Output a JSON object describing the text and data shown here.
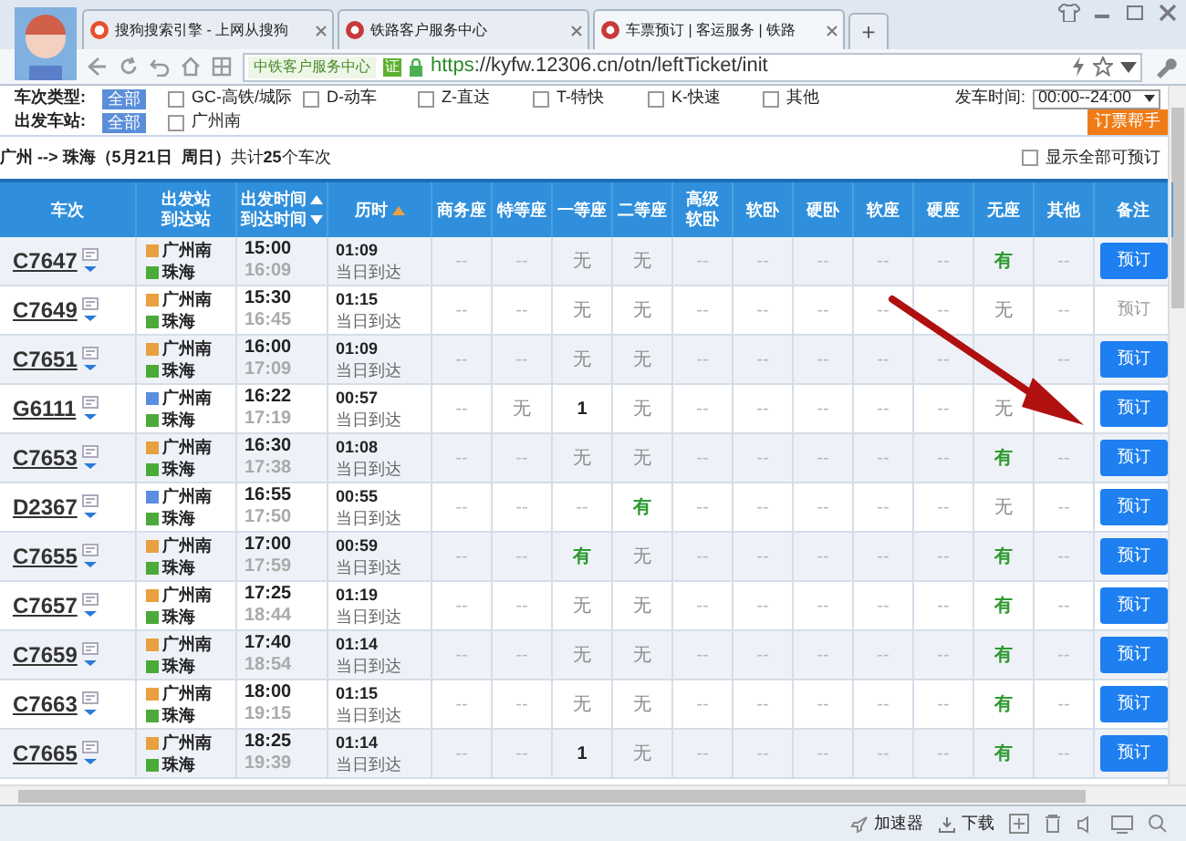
{
  "browser": {
    "tabs": [
      {
        "label": "搜狗搜索引擎 - 上网从搜狗",
        "selected": false
      },
      {
        "label": "铁路客户服务中心",
        "selected": false
      },
      {
        "label": "车票预订 | 客运服务 | 铁路",
        "selected": true
      }
    ],
    "new_tab": "+",
    "site_badge": "中铁客户服务中心",
    "badge_mark": "证",
    "url_scheme": "https",
    "url_rest": "://kyfw.12306.cn/otn/leftTicket/init"
  },
  "filters": {
    "type_label": "车次类型:",
    "type_all": "全部",
    "type_options": [
      {
        "label": "GC-高铁/城际",
        "checked": false
      },
      {
        "label": "D-动车",
        "checked": false
      },
      {
        "label": "Z-直达",
        "checked": false
      },
      {
        "label": "T-特快",
        "checked": false
      },
      {
        "label": "K-快速",
        "checked": false
      },
      {
        "label": "其他",
        "checked": false
      }
    ],
    "time_label": "发车时间:",
    "time_value": "00:00--24:00",
    "station_label": "出发车站:",
    "station_all": "全部",
    "station_options": [
      {
        "label": "广州南",
        "checked": false
      }
    ],
    "helper_button": "订票帮手"
  },
  "route": {
    "text": "**广州 --> 珠海（5月21日  周日）**共计**25**个车次",
    "show_all": {
      "label": "显示全部可预订",
      "checked": false
    }
  },
  "table": {
    "columns": [
      {
        "lines": [
          "车次"
        ]
      },
      {
        "lines": [
          "出发站",
          "到达站"
        ]
      },
      {
        "lines": [
          "出发时间",
          "到达时间"
        ],
        "sort_active": false
      },
      {
        "lines": [
          "历时"
        ],
        "sort_active": true
      },
      {
        "lines": [
          "商务座"
        ]
      },
      {
        "lines": [
          "特等座"
        ]
      },
      {
        "lines": [
          "一等座"
        ]
      },
      {
        "lines": [
          "二等座"
        ]
      },
      {
        "lines": [
          "高级",
          "软卧"
        ]
      },
      {
        "lines": [
          "软卧"
        ]
      },
      {
        "lines": [
          "硬卧"
        ]
      },
      {
        "lines": [
          "软座"
        ]
      },
      {
        "lines": [
          "硬座"
        ]
      },
      {
        "lines": [
          "无座"
        ]
      },
      {
        "lines": [
          "其他"
        ]
      },
      {
        "lines": [
          "备注"
        ]
      }
    ],
    "rows": [
      {
        "train": "C7647",
        "color": "#e8a040",
        "from": "广州南",
        "to": "珠海",
        "depart": "15:00",
        "arrive": "16:09",
        "duration": "01:09",
        "arrival_day": "当日到达",
        "seats": [
          {
            "text": "--",
            "kind": "na"
          },
          {
            "text": "--",
            "kind": "na"
          },
          {
            "text": "无",
            "kind": "none"
          },
          {
            "text": "无",
            "kind": "none"
          },
          {
            "text": "--",
            "kind": "na"
          },
          {
            "text": "--",
            "kind": "na"
          },
          {
            "text": "--",
            "kind": "na"
          },
          {
            "text": "--",
            "kind": "na"
          },
          {
            "text": "--",
            "kind": "na"
          },
          {
            "text": "有",
            "kind": "available"
          },
          {
            "text": "--",
            "kind": "na"
          }
        ],
        "book": {
          "label": "预订",
          "disabled": false
        }
      },
      {
        "train": "C7649",
        "color": "#e8a040",
        "from": "广州南",
        "to": "珠海",
        "depart": "15:30",
        "arrive": "16:45",
        "duration": "01:15",
        "arrival_day": "当日到达",
        "seats": [
          {
            "text": "--",
            "kind": "na"
          },
          {
            "text": "--",
            "kind": "na"
          },
          {
            "text": "无",
            "kind": "none"
          },
          {
            "text": "无",
            "kind": "none"
          },
          {
            "text": "--",
            "kind": "na"
          },
          {
            "text": "--",
            "kind": "na"
          },
          {
            "text": "--",
            "kind": "na"
          },
          {
            "text": "--",
            "kind": "na"
          },
          {
            "text": "--",
            "kind": "na"
          },
          {
            "text": "无",
            "kind": "none"
          },
          {
            "text": "--",
            "kind": "na"
          }
        ],
        "book": {
          "label": "预订",
          "disabled": true
        }
      },
      {
        "train": "C7651",
        "color": "#e8a040",
        "from": "广州南",
        "to": "珠海",
        "depart": "16:00",
        "arrive": "17:09",
        "duration": "01:09",
        "arrival_day": "当日到达",
        "seats": [
          {
            "text": "--",
            "kind": "na"
          },
          {
            "text": "--",
            "kind": "na"
          },
          {
            "text": "无",
            "kind": "none"
          },
          {
            "text": "无",
            "kind": "none"
          },
          {
            "text": "--",
            "kind": "na"
          },
          {
            "text": "--",
            "kind": "na"
          },
          {
            "text": "--",
            "kind": "na"
          },
          {
            "text": "--",
            "kind": "na"
          },
          {
            "text": "--",
            "kind": "na"
          },
          {
            "kind": "covered"
          },
          {
            "text": "--",
            "kind": "na"
          }
        ],
        "book": {
          "label": "预订",
          "disabled": false
        }
      },
      {
        "train": "G6111",
        "color": "#5b8de0",
        "from": "广州南",
        "to": "珠海",
        "depart": "16:22",
        "arrive": "17:19",
        "duration": "00:57",
        "arrival_day": "当日到达",
        "seats": [
          {
            "text": "--",
            "kind": "na"
          },
          {
            "text": "无",
            "kind": "none"
          },
          {
            "text": "1",
            "kind": "count"
          },
          {
            "text": "无",
            "kind": "none"
          },
          {
            "text": "--",
            "kind": "na"
          },
          {
            "text": "--",
            "kind": "na"
          },
          {
            "text": "--",
            "kind": "na"
          },
          {
            "text": "--",
            "kind": "na"
          },
          {
            "text": "--",
            "kind": "na"
          },
          {
            "text": "无",
            "kind": "none"
          }
        ],
        "book": {
          "label": "预订",
          "disabled": false
        }
      },
      {
        "train": "C7653",
        "color": "#e8a040",
        "from": "广州南",
        "to": "珠海",
        "depart": "16:30",
        "arrive": "17:38",
        "duration": "01:08",
        "arrival_day": "当日到达",
        "seats": [
          {
            "text": "--",
            "kind": "na"
          },
          {
            "text": "--",
            "kind": "na"
          },
          {
            "text": "无",
            "kind": "none"
          },
          {
            "text": "无",
            "kind": "none"
          },
          {
            "text": "--",
            "kind": "na"
          },
          {
            "text": "--",
            "kind": "na"
          },
          {
            "text": "--",
            "kind": "na"
          },
          {
            "text": "--",
            "kind": "na"
          },
          {
            "text": "--",
            "kind": "na"
          },
          {
            "text": "有",
            "kind": "available"
          },
          {
            "text": "--",
            "kind": "na"
          }
        ],
        "book": {
          "label": "预订",
          "disabled": false
        }
      },
      {
        "train": "D2367",
        "color": "#5b8de0",
        "from": "广州南",
        "to": "珠海",
        "depart": "16:55",
        "arrive": "17:50",
        "duration": "00:55",
        "arrival_day": "当日到达",
        "seats": [
          {
            "text": "--",
            "kind": "na"
          },
          {
            "text": "--",
            "kind": "na"
          },
          {
            "text": "--",
            "kind": "na"
          },
          {
            "text": "有",
            "kind": "available"
          },
          {
            "text": "--",
            "kind": "na"
          },
          {
            "text": "--",
            "kind": "na"
          },
          {
            "text": "--",
            "kind": "na"
          },
          {
            "text": "--",
            "kind": "na"
          },
          {
            "text": "--",
            "kind": "na"
          },
          {
            "text": "无",
            "kind": "none"
          },
          {
            "text": "--",
            "kind": "na"
          }
        ],
        "book": {
          "label": "预订",
          "disabled": false
        }
      },
      {
        "train": "C7655",
        "color": "#e8a040",
        "from": "广州南",
        "to": "珠海",
        "depart": "17:00",
        "arrive": "17:59",
        "duration": "00:59",
        "arrival_day": "当日到达",
        "seats": [
          {
            "text": "--",
            "kind": "na"
          },
          {
            "text": "--",
            "kind": "na"
          },
          {
            "text": "有",
            "kind": "available"
          },
          {
            "text": "无",
            "kind": "none"
          },
          {
            "text": "--",
            "kind": "na"
          },
          {
            "text": "--",
            "kind": "na"
          },
          {
            "text": "--",
            "kind": "na"
          },
          {
            "text": "--",
            "kind": "na"
          },
          {
            "text": "--",
            "kind": "na"
          },
          {
            "text": "有",
            "kind": "available"
          },
          {
            "text": "--",
            "kind": "na"
          }
        ],
        "book": {
          "label": "预订",
          "disabled": false
        }
      },
      {
        "train": "C7657",
        "color": "#e8a040",
        "from": "广州南",
        "to": "珠海",
        "depart": "17:25",
        "arrive": "18:44",
        "duration": "01:19",
        "arrival_day": "当日到达",
        "seats": [
          {
            "text": "--",
            "kind": "na"
          },
          {
            "text": "--",
            "kind": "na"
          },
          {
            "text": "无",
            "kind": "none"
          },
          {
            "text": "无",
            "kind": "none"
          },
          {
            "text": "--",
            "kind": "na"
          },
          {
            "text": "--",
            "kind": "na"
          },
          {
            "text": "--",
            "kind": "na"
          },
          {
            "text": "--",
            "kind": "na"
          },
          {
            "text": "--",
            "kind": "na"
          },
          {
            "text": "有",
            "kind": "available"
          },
          {
            "text": "--",
            "kind": "na"
          }
        ],
        "book": {
          "label": "预订",
          "disabled": false
        }
      },
      {
        "train": "C7659",
        "color": "#e8a040",
        "from": "广州南",
        "to": "珠海",
        "depart": "17:40",
        "arrive": "18:54",
        "duration": "01:14",
        "arrival_day": "当日到达",
        "seats": [
          {
            "text": "--",
            "kind": "na"
          },
          {
            "text": "--",
            "kind": "na"
          },
          {
            "text": "无",
            "kind": "none"
          },
          {
            "text": "无",
            "kind": "none"
          },
          {
            "text": "--",
            "kind": "na"
          },
          {
            "text": "--",
            "kind": "na"
          },
          {
            "text": "--",
            "kind": "na"
          },
          {
            "text": "--",
            "kind": "na"
          },
          {
            "text": "--",
            "kind": "na"
          },
          {
            "text": "有",
            "kind": "available"
          },
          {
            "text": "--",
            "kind": "na"
          }
        ],
        "book": {
          "label": "预订",
          "disabled": false
        }
      },
      {
        "train": "C7663",
        "color": "#e8a040",
        "from": "广州南",
        "to": "珠海",
        "depart": "18:00",
        "arrive": "19:15",
        "duration": "01:15",
        "arrival_day": "当日到达",
        "seats": [
          {
            "text": "--",
            "kind": "na"
          },
          {
            "text": "--",
            "kind": "na"
          },
          {
            "text": "无",
            "kind": "none"
          },
          {
            "text": "无",
            "kind": "none"
          },
          {
            "text": "--",
            "kind": "na"
          },
          {
            "text": "--",
            "kind": "na"
          },
          {
            "text": "--",
            "kind": "na"
          },
          {
            "text": "--",
            "kind": "na"
          },
          {
            "text": "--",
            "kind": "na"
          },
          {
            "text": "有",
            "kind": "available"
          },
          {
            "text": "--",
            "kind": "na"
          }
        ],
        "book": {
          "label": "预订",
          "disabled": false
        }
      },
      {
        "train": "C7665",
        "color": "#e8a040",
        "from": "广州南",
        "to": "珠海",
        "depart": "18:25",
        "arrive": "19:39",
        "duration": "01:14",
        "arrival_day": "当日到达",
        "seats": [
          {
            "text": "--",
            "kind": "na"
          },
          {
            "text": "--",
            "kind": "na"
          },
          {
            "text": "1",
            "kind": "count"
          },
          {
            "text": "无",
            "kind": "none"
          },
          {
            "text": "--",
            "kind": "na"
          },
          {
            "text": "--",
            "kind": "na"
          },
          {
            "text": "--",
            "kind": "na"
          },
          {
            "text": "--",
            "kind": "na"
          },
          {
            "text": "--",
            "kind": "na"
          },
          {
            "text": "有",
            "kind": "available"
          },
          {
            "text": "--",
            "kind": "na"
          }
        ],
        "book": {
          "label": "预订",
          "disabled": false
        }
      }
    ]
  },
  "status_bar": {
    "items": [
      {
        "label": "加速器"
      },
      {
        "label": "下载"
      }
    ]
  }
}
